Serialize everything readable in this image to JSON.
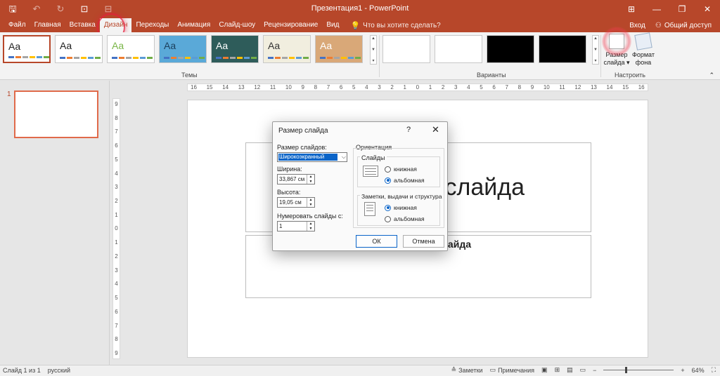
{
  "window": {
    "title": "Презентация1 - PowerPoint"
  },
  "qat": [
    {
      "name": "save-icon",
      "glyph": "🖫"
    },
    {
      "name": "undo-icon",
      "glyph": "↶"
    },
    {
      "name": "redo-icon",
      "glyph": "↻"
    },
    {
      "name": "start-slideshow-icon",
      "glyph": "⊡"
    },
    {
      "name": "customize-qat-icon",
      "glyph": "⊟"
    }
  ],
  "tabs": [
    {
      "label": "Файл",
      "name": "tab-file"
    },
    {
      "label": "Главная",
      "name": "tab-home"
    },
    {
      "label": "Вставка",
      "name": "tab-insert"
    },
    {
      "label": "Дизайн",
      "name": "tab-design",
      "active": true
    },
    {
      "label": "Переходы",
      "name": "tab-transitions"
    },
    {
      "label": "Анимация",
      "name": "tab-animations"
    },
    {
      "label": "Слайд-шоу",
      "name": "tab-slideshow"
    },
    {
      "label": "Рецензирование",
      "name": "tab-review"
    },
    {
      "label": "Вид",
      "name": "tab-view"
    }
  ],
  "tellme": "Что вы хотите сделать?",
  "signin": "Вход",
  "share": "Общий доступ",
  "ribbon": {
    "themes_group": "Темы",
    "variants_group": "Варианты",
    "customize_group": "Настроить",
    "slide_size_label_line1": "Размер",
    "slide_size_label_line2": "слайда",
    "format_bg_label_line1": "Формат",
    "format_bg_label_line2": "фона",
    "themes": [
      {
        "aa": "Aa",
        "bg": "#ffffff",
        "fg": "#222222",
        "selected": true
      },
      {
        "aa": "Aa",
        "bg": "#ffffff",
        "fg": "#222222"
      },
      {
        "aa": "Aa",
        "bg": "#ffffff",
        "fg": "#7ab648"
      },
      {
        "aa": "Aa",
        "bg": "#5aa9d8",
        "fg": "#1b3f5c"
      },
      {
        "aa": "Aa",
        "bg": "#2e5c5a",
        "fg": "#ffffff"
      },
      {
        "aa": "Aa",
        "bg": "#f1eedf",
        "fg": "#333333"
      },
      {
        "aa": "Aa",
        "bg": "#d9a878",
        "fg": "#ffffff"
      }
    ],
    "variants": [
      {
        "bg": "#ffffff"
      },
      {
        "bg": "#ffffff"
      },
      {
        "bg": "#000000"
      },
      {
        "bg": "#000000"
      }
    ],
    "bar_colors": [
      "#4472c4",
      "#ed7d31",
      "#a5a5a5",
      "#ffc000",
      "#5b9bd5",
      "#70ad47"
    ]
  },
  "thumbnails": [
    {
      "number": "1"
    }
  ],
  "ruler": {
    "horizontal": [
      "16",
      "15",
      "14",
      "13",
      "12",
      "11",
      "10",
      "9",
      "8",
      "7",
      "6",
      "5",
      "4",
      "3",
      "2",
      "1",
      "0",
      "1",
      "2",
      "3",
      "4",
      "5",
      "6",
      "7",
      "8",
      "9",
      "10",
      "11",
      "12",
      "13",
      "14",
      "15",
      "16"
    ],
    "vertical": [
      "9",
      "8",
      "7",
      "6",
      "5",
      "4",
      "3",
      "2",
      "1",
      "0",
      "1",
      "2",
      "3",
      "4",
      "5",
      "6",
      "7",
      "8",
      "9"
    ]
  },
  "slide": {
    "title_text": "слайда",
    "subtitle_text": "айда"
  },
  "dialog": {
    "title": "Размер слайда",
    "help": "?",
    "close": "✕",
    "size_label": "Размер слайдов:",
    "size_value": "Широкоэкранный",
    "width_label": "Ширина:",
    "width_value": "33,867 см",
    "height_label": "Высота:",
    "height_value": "19,05 см",
    "number_label": "Нумеровать слайды с:",
    "number_value": "1",
    "orientation_label": "Ориентация",
    "slides_label": "Слайды",
    "portrait_label": "книжная",
    "landscape_label": "альбомная",
    "notes_label": "Заметки, выдачи и структура",
    "notes_portrait_label": "книжная",
    "notes_landscape_label": "альбомная",
    "ok": "ОК",
    "cancel": "Отмена"
  },
  "status": {
    "slide_info": "Слайд 1 из 1",
    "language": "русский",
    "notes": "Заметки",
    "comments": "Примечания",
    "zoom": "64%",
    "zoom_level": 0.64
  }
}
